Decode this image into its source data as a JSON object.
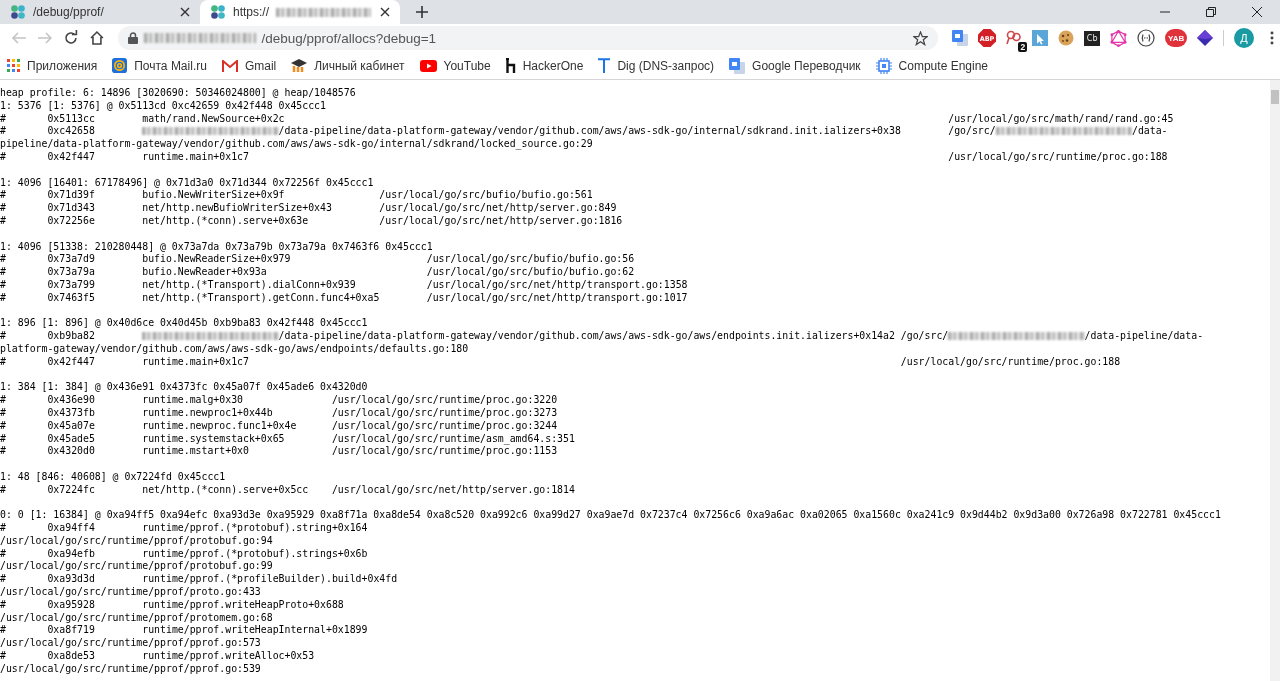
{
  "tabs": [
    {
      "title": "/debug/pprof/",
      "blurred": false,
      "selected": false
    },
    {
      "title": "https://",
      "blurred": true,
      "selected": true
    }
  ],
  "nav": {
    "back": {
      "disabled": true
    },
    "forward": {
      "disabled": true
    }
  },
  "address": {
    "host_blurred": true,
    "path": "/debug/pprof/allocs?debug=1"
  },
  "extensions": [
    {
      "kind": "translate"
    },
    {
      "kind": "stop",
      "label": "ABP"
    },
    {
      "kind": "pin",
      "badge": "2"
    },
    {
      "kind": "cursor"
    },
    {
      "kind": "cookie"
    },
    {
      "kind": "tile",
      "label": "Cb"
    },
    {
      "kind": "hexagon"
    },
    {
      "kind": "braces"
    },
    {
      "kind": "round",
      "label": "YAB"
    },
    {
      "kind": "diamond"
    }
  ],
  "profile": {
    "initial": "Д"
  },
  "bookmarks": [
    {
      "kind": "apps",
      "label": "Приложения"
    },
    {
      "kind": "mail",
      "label": "Почта Mail.ru"
    },
    {
      "kind": "gmail",
      "label": "Gmail"
    },
    {
      "kind": "hat",
      "label": "Личный кабинет"
    },
    {
      "kind": "play",
      "label": "YouTube"
    },
    {
      "kind": "h",
      "label": "HackerOne"
    },
    {
      "kind": "t",
      "label": "Dig (DNS-запрос)"
    },
    {
      "kind": "translate",
      "label": "Google Переводчик"
    },
    {
      "kind": "chip",
      "label": "Compute Engine"
    }
  ],
  "blocks": [
    {
      "lines": [
        {
          "text": "heap profile: 6: 14896 [3020690: 50346024800] @ heap/1048576"
        },
        {
          "text": "1: 5376 [1: 5376] @ 0x5113cd 0xc42659 0x42f448 0x45ccc1"
        },
        {
          "text": "#\t0x5113cc\tmath/rand.NewSource+0x2c\t\t\t\t\t\t\t\t\t\t\t\t\t\t/usr/local/go/src/math/rand/rand.go:45"
        },
        {
          "parts": [
            {
              "kind": "text",
              "text": "#\t0xc42658\t"
            },
            {
              "kind": "blurred"
            },
            {
              "kind": "text",
              "text": "/data-pipeline/data-platform-gateway/vendor/github.com/aws/aws-sdk-go/internal/sdkrand.init.ializers+0x38\t/go/src/"
            },
            {
              "kind": "blurred"
            },
            {
              "kind": "text",
              "text": "/data-"
            }
          ]
        },
        {
          "text": "pipeline/data-platform-gateway/vendor/github.com/aws/aws-sdk-go/internal/sdkrand/locked_source.go:29"
        },
        {
          "text": "#\t0x42f447\truntime.main+0x1c7\t\t\t\t\t\t\t\t\t\t\t\t\t\t\t/usr/local/go/src/runtime/proc.go:188"
        }
      ]
    },
    {
      "lines": [
        {
          "text": "1: 4096 [16401: 67178496] @ 0x71d3a0 0x71d344 0x72256f 0x45ccc1"
        },
        {
          "text": "#\t0x71d39f\tbufio.NewWriterSize+0x9f\t\t/usr/local/go/src/bufio/bufio.go:561"
        },
        {
          "text": "#\t0x71d343\tnet/http.newBufioWriterSize+0x43\t/usr/local/go/src/net/http/server.go:849"
        },
        {
          "text": "#\t0x72256e\tnet/http.(*conn).serve+0x63e\t\t/usr/local/go/src/net/http/server.go:1816"
        }
      ]
    },
    {
      "lines": [
        {
          "text": "1: 4096 [51338: 210280448] @ 0x73a7da 0x73a79b 0x73a79a 0x7463f6 0x45ccc1"
        },
        {
          "text": "#\t0x73a7d9\tbufio.NewReaderSize+0x979\t\t\t/usr/local/go/src/bufio/bufio.go:56"
        },
        {
          "text": "#\t0x73a79a\tbufio.NewReader+0x93a\t\t\t\t/usr/local/go/src/bufio/bufio.go:62"
        },
        {
          "text": "#\t0x73a799\tnet/http.(*Transport).dialConn+0x939\t\t/usr/local/go/src/net/http/transport.go:1358"
        },
        {
          "text": "#\t0x7463f5\tnet/http.(*Transport).getConn.func4+0xa5\t/usr/local/go/src/net/http/transport.go:1017"
        }
      ]
    },
    {
      "lines": [
        {
          "text": "1: 896 [1: 896] @ 0x40d6ce 0x40d45b 0xb9ba83 0x42f448 0x45ccc1"
        },
        {
          "parts": [
            {
              "kind": "text",
              "text": "#\t0xb9ba82\t"
            },
            {
              "kind": "blurred"
            },
            {
              "kind": "text",
              "text": "/data-pipeline/data-platform-gateway/vendor/github.com/aws/aws-sdk-go/aws/endpoints.init.ializers+0x14a2\t/go/src/"
            },
            {
              "kind": "blurred"
            },
            {
              "kind": "text",
              "text": "/data-pipeline/data-"
            }
          ]
        },
        {
          "text": "platform-gateway/vendor/github.com/aws/aws-sdk-go/aws/endpoints/defaults.go:180"
        },
        {
          "text": "#\t0x42f447\truntime.main+0x1c7\t\t\t\t\t\t\t\t\t\t\t\t\t\t/usr/local/go/src/runtime/proc.go:188"
        }
      ]
    },
    {
      "lines": [
        {
          "text": "1: 384 [1: 384] @ 0x436e91 0x4373fc 0x45a07f 0x45ade6 0x4320d0"
        },
        {
          "text": "#\t0x436e90\truntime.malg+0x30\t\t/usr/local/go/src/runtime/proc.go:3220"
        },
        {
          "text": "#\t0x4373fb\truntime.newproc1+0x44b\t\t/usr/local/go/src/runtime/proc.go:3273"
        },
        {
          "text": "#\t0x45a07e\truntime.newproc.func1+0x4e\t/usr/local/go/src/runtime/proc.go:3244"
        },
        {
          "text": "#\t0x45ade5\truntime.systemstack+0x65\t/usr/local/go/src/runtime/asm_amd64.s:351"
        },
        {
          "text": "#\t0x4320d0\truntime.mstart+0x0\t\t/usr/local/go/src/runtime/proc.go:1153"
        }
      ]
    },
    {
      "lines": [
        {
          "text": "1: 48 [846: 40608] @ 0x7224fd 0x45ccc1"
        },
        {
          "text": "#\t0x7224fc\tnet/http.(*conn).serve+0x5cc\t/usr/local/go/src/net/http/server.go:1814"
        }
      ]
    },
    {
      "lines": [
        {
          "text": "0: 0 [1: 16384] @ 0xa94ff5 0xa94efc 0xa93d3e 0xa95929 0xa8f71a 0xa8de54 0xa8c520 0xa992c6 0xa99d27 0xa9ae7d 0x7237c4 0x7256c6 0xa9a6ac 0xa02065 0xa1560c 0xa241c9 0x9d44b2 0x9d3a00 0x726a98 0x722781 0x45ccc1"
        },
        {
          "text": "#\t0xa94ff4\truntime/pprof.(*protobuf).string+0x164"
        },
        {
          "text": "/usr/local/go/src/runtime/pprof/protobuf.go:94"
        },
        {
          "text": "#\t0xa94efb\truntime/pprof.(*protobuf).strings+0x6b"
        },
        {
          "text": "/usr/local/go/src/runtime/pprof/protobuf.go:99"
        },
        {
          "text": "#\t0xa93d3d\truntime/pprof.(*profileBuilder).build+0x4fd"
        },
        {
          "text": "/usr/local/go/src/runtime/pprof/proto.go:433"
        },
        {
          "text": "#\t0xa95928\truntime/pprof.writeHeapProto+0x688"
        },
        {
          "text": "/usr/local/go/src/runtime/pprof/protomem.go:68"
        },
        {
          "text": "#\t0xa8f719\truntime/pprof.writeHeapInternal+0x1899"
        },
        {
          "text": "/usr/local/go/src/runtime/pprof/pprof.go:573"
        },
        {
          "text": "#\t0xa8de53\truntime/pprof.writeAlloc+0x53"
        },
        {
          "text": "/usr/local/go/src/runtime/pprof/pprof.go:539"
        }
      ]
    }
  ]
}
